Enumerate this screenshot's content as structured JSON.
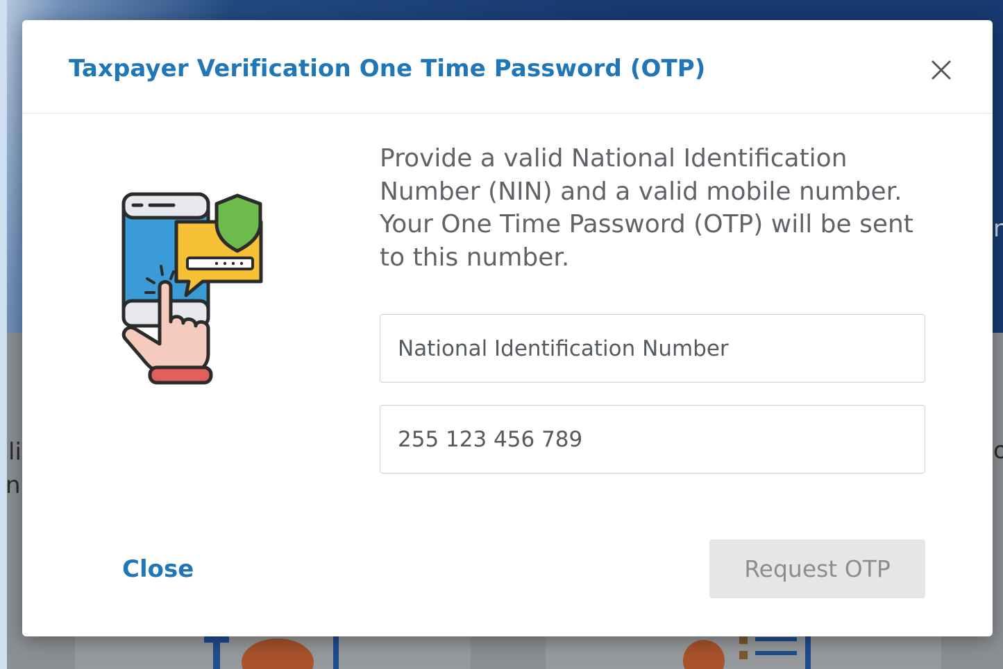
{
  "modal": {
    "title": "Taxpayer Verification One Time Password (OTP)",
    "close_icon": "close-icon",
    "illustration_icon": "phone-otp-shield-icon",
    "description": "Provide a valid National Identification Number (NIN) and a valid mobile number. Your One Time Password (OTP) will be sent to this number.",
    "nin_field": {
      "placeholder": "National Identification Number",
      "value": ""
    },
    "phone_field": {
      "placeholder": "255 123 456 789",
      "value": ""
    },
    "close_label": "Close",
    "request_label": "Request OTP"
  },
  "background": {
    "frag_left_1": "li",
    "frag_left_2": "n",
    "frag_right_top": "n",
    "frag_right_mid": "o"
  },
  "colors": {
    "accent": "#1f77b8",
    "header_bg": "#173a70",
    "disabled_button": "#e6e6e6"
  }
}
